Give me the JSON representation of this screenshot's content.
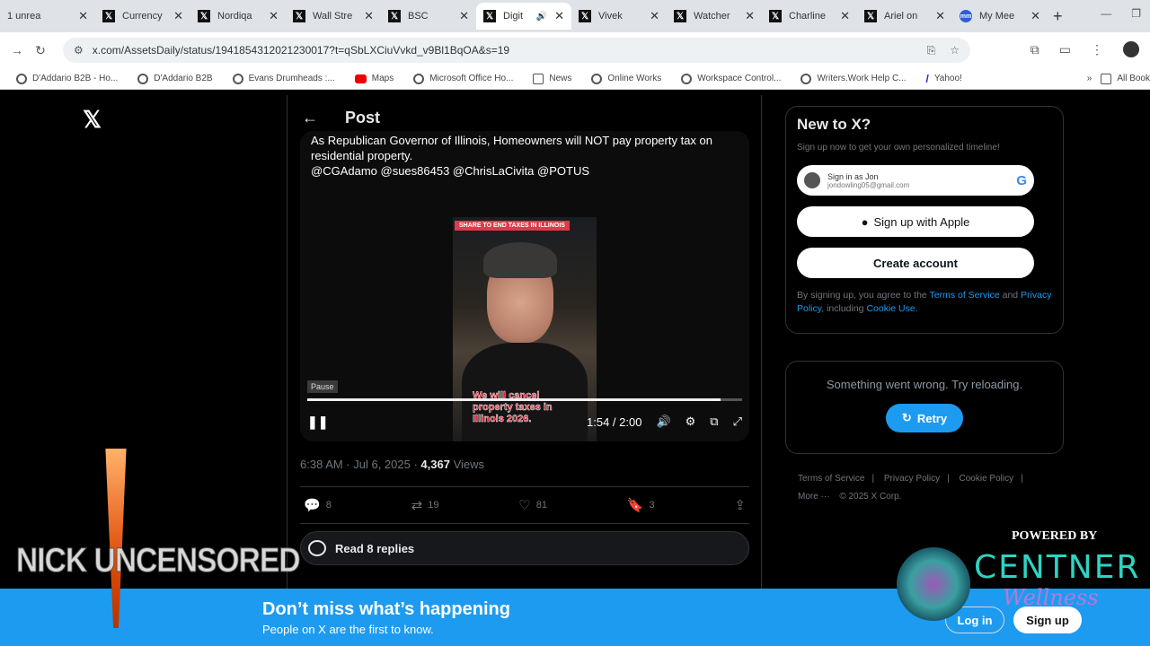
{
  "browser": {
    "tabs": [
      {
        "label": "1 unrea",
        "icon": "",
        "active": false
      },
      {
        "label": "Currency",
        "icon": "x-logo-icon",
        "active": false
      },
      {
        "label": "Nordiqa",
        "icon": "x-logo-icon",
        "active": false
      },
      {
        "label": "Wall Stre",
        "icon": "x-logo-icon",
        "active": false
      },
      {
        "label": "BSC",
        "icon": "x-logo-icon",
        "active": false
      },
      {
        "label": "Digit",
        "icon": "x-logo-icon",
        "active": true
      },
      {
        "label": "Vivek",
        "icon": "x-logo-icon",
        "active": false
      },
      {
        "label": "Watcher",
        "icon": "x-logo-icon",
        "active": false
      },
      {
        "label": "Charline",
        "icon": "x-logo-icon",
        "active": false
      },
      {
        "label": "Ariel on",
        "icon": "x-logo-icon",
        "active": false
      },
      {
        "label": "My Mee",
        "icon": "mm-icon",
        "active": false
      }
    ],
    "url": "x.com/AssetsDaily/status/1941854312021230017?t=qSbLXCiuVvkd_v9Bl1BqOA&s=19",
    "bookmarks": [
      {
        "label": "D'Addario B2B - Ho...",
        "icon": "globe-icon"
      },
      {
        "label": "D'Addario B2B",
        "icon": "globe-icon"
      },
      {
        "label": "Evans Drumheads :...",
        "icon": "globe-icon"
      },
      {
        "label": "Maps",
        "icon": "youtube-icon"
      },
      {
        "label": "Microsoft Office Ho...",
        "icon": "globe-icon"
      },
      {
        "label": "News",
        "icon": "folder-icon"
      },
      {
        "label": "Online Works",
        "icon": "globe-icon"
      },
      {
        "label": "Workspace Control...",
        "icon": "globe-icon"
      },
      {
        "label": "Writers.Work Help C...",
        "icon": "globe-icon"
      },
      {
        "label": "Yahoo!",
        "icon": "yahoo-icon"
      }
    ],
    "bookmarks_more": "»",
    "all_bookmarks": "All Book"
  },
  "post": {
    "header_title": "Post",
    "text_line1": "As Republican Governor of Illinois, Homeowners will NOT pay property tax on",
    "text_line2": "residential property.",
    "mentions": "@CGAdamo @sues86453 @ChrisLaCivita @POTUS",
    "video_banner": "SHARE TO END TAXES IN ILLINOIS",
    "video_caption": "We will cancel property taxes in Illinois 2026.",
    "pause_tooltip": "Pause",
    "progress": 0.95,
    "time": "1:54 / 2:00",
    "timestamp": "6:38 AM · Jul 6, 2025 · ",
    "views_count": "4,367",
    "views_label": " Views",
    "replies": "8",
    "reposts": "19",
    "likes": "81",
    "bookmarks": "3",
    "read_replies": "Read 8 replies"
  },
  "sidebar": {
    "title": "New to X?",
    "subtitle": "Sign up now to get your own personalized timeline!",
    "google_name": "Sign in as Jon",
    "google_email": "jondowling05@gmail.com",
    "apple_label": "Sign up with Apple",
    "create_label": "Create account",
    "terms_prefix": "By signing up, you agree to the ",
    "terms_link": "Terms of Service",
    "terms_and": " and ",
    "privacy_link": "Privacy Policy",
    "terms_including": ", including ",
    "cookie_link": "Cookie Use",
    "terms_end": ".",
    "error_text": "Something went wrong. Try reloading.",
    "retry_label": "Retry",
    "footer": [
      "Terms of Service",
      "|",
      "Privacy Policy",
      "|",
      "Cookie Policy",
      "|",
      "More ···",
      "© 2025 X Corp."
    ]
  },
  "banner": {
    "title": "Don’t miss what’s happening",
    "subtitle": "People on X are the first to know.",
    "login": "Log in",
    "signup": "Sign up"
  },
  "overlays": {
    "nick_text": "NICK UNCENSORED",
    "powered_by": "POWERED BY",
    "centner": "CENTNER",
    "wellness": "Wellness"
  },
  "colors": {
    "x_blue": "#1d9bf0",
    "background": "#000000",
    "border": "#2f3336"
  }
}
